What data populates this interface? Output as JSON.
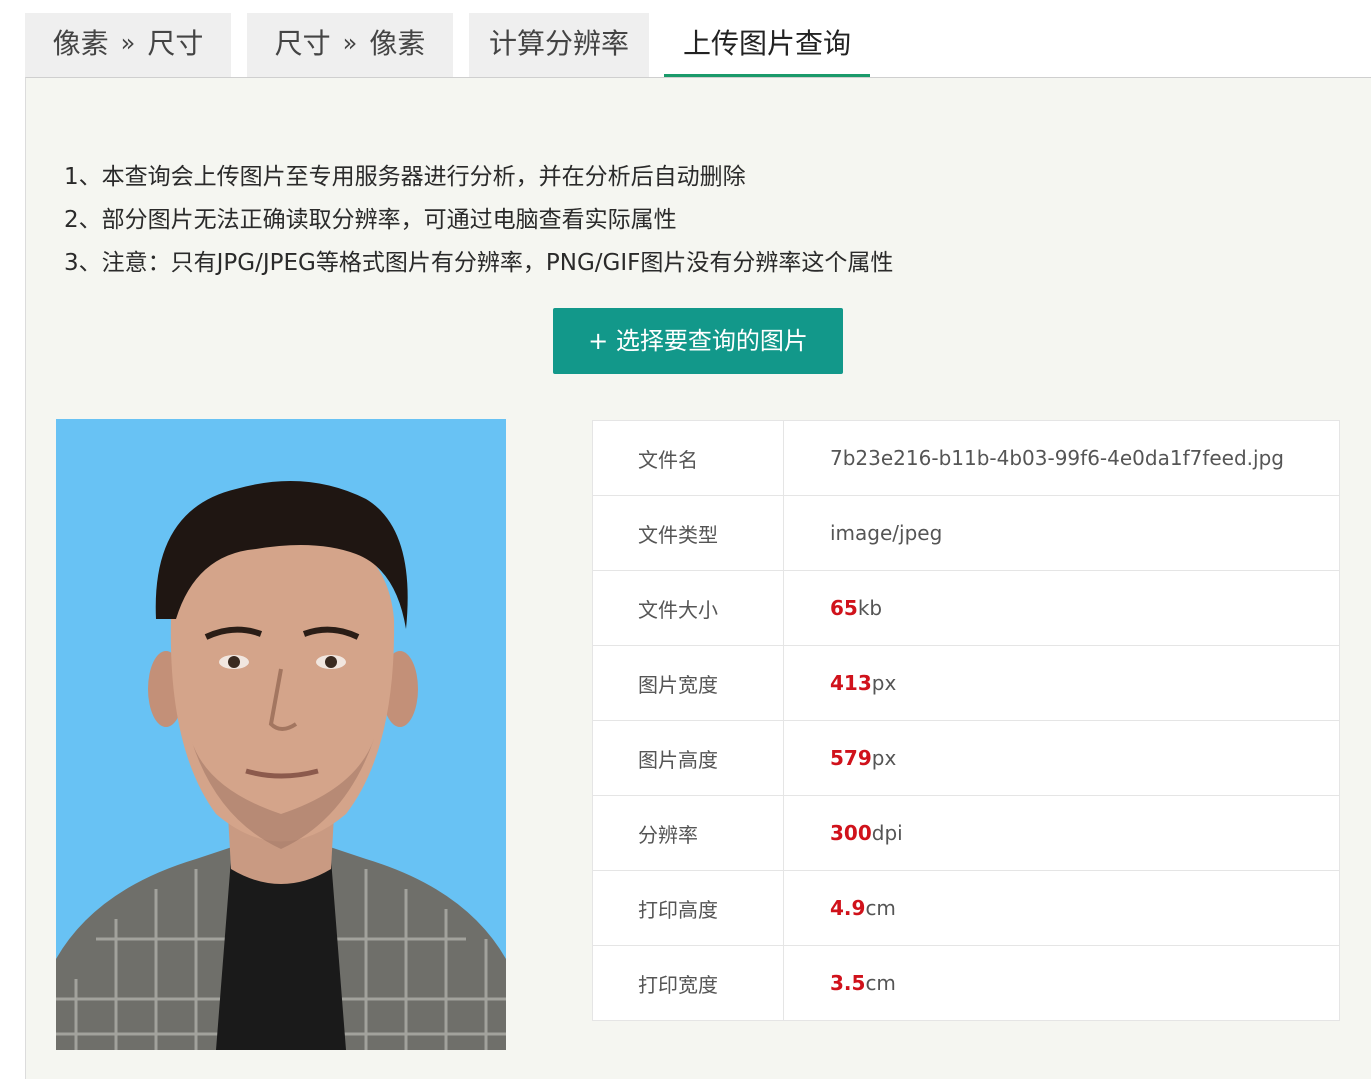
{
  "tabs": [
    {
      "left": "像素",
      "right": "尺寸",
      "sep": "»"
    },
    {
      "left": "尺寸",
      "right": "像素",
      "sep": "»"
    },
    {
      "label": "计算分辨率"
    },
    {
      "label": "上传图片查询"
    }
  ],
  "notes": [
    "1、本查询会上传图片至专用服务器进行分析，并在分析后自动删除",
    "2、部分图片无法正确读取分辨率，可通过电脑查看实际属性",
    "3、注意：只有JPG/JPEG等格式图片有分辨率，PNG/GIF图片没有分辨率这个属性"
  ],
  "upload_button": "+ 选择要查询的图片",
  "info": {
    "file_name": {
      "label": "文件名",
      "value": "7b23e216-b11b-4b03-99f6-4e0da1f7feed.jpg"
    },
    "file_type": {
      "label": "文件类型",
      "value": "image/jpeg"
    },
    "file_size": {
      "label": "文件大小",
      "num": "65",
      "unit": "kb"
    },
    "width": {
      "label": "图片宽度",
      "num": "413",
      "unit": "px"
    },
    "height": {
      "label": "图片高度",
      "num": "579",
      "unit": "px"
    },
    "resolution": {
      "label": "分辨率",
      "num": "300",
      "unit": "dpi"
    },
    "print_height": {
      "label": "打印高度",
      "num": "4.9",
      "unit": "cm"
    },
    "print_width": {
      "label": "打印宽度",
      "num": "3.5",
      "unit": "cm"
    }
  },
  "colors": {
    "accent": "#12988a",
    "tab_active": "#1a9a6a",
    "value_red": "#d0121b",
    "photo_bg": "#68c2f4"
  }
}
